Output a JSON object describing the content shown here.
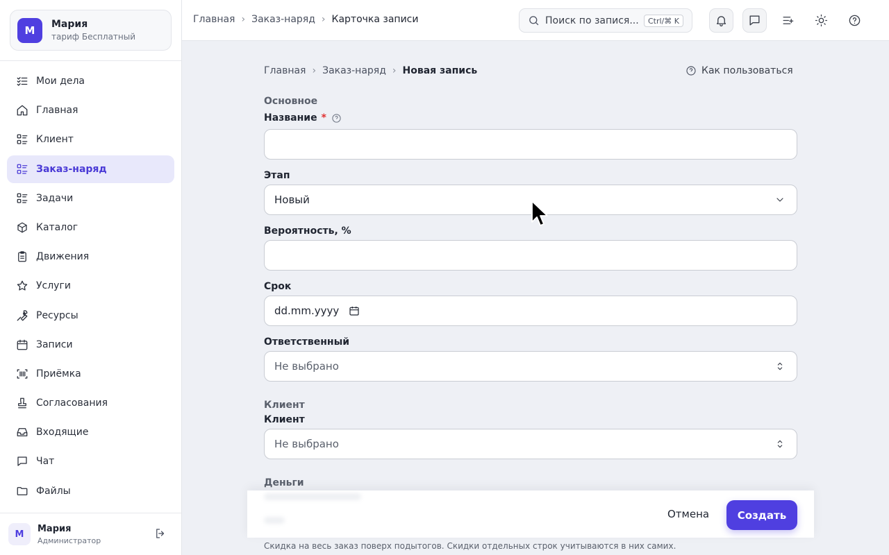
{
  "account": {
    "initial": "M",
    "name": "Мария",
    "plan": "тариф Бесплатный"
  },
  "sidebar": {
    "items": [
      {
        "label": "Мои дела",
        "icon": "checklist-icon"
      },
      {
        "label": "Главная",
        "icon": "home-icon"
      },
      {
        "label": "Клиент",
        "icon": "list-icon"
      },
      {
        "label": "Заказ-наряд",
        "icon": "list-icon",
        "active": true
      },
      {
        "label": "Задачи",
        "icon": "list-icon"
      },
      {
        "label": "Каталог",
        "icon": "box-icon"
      },
      {
        "label": "Движения",
        "icon": "clipboard-icon"
      },
      {
        "label": "Услуги",
        "icon": "star-icon"
      },
      {
        "label": "Ресурсы",
        "icon": "wrench-icon"
      },
      {
        "label": "Записи",
        "icon": "calendar-icon"
      },
      {
        "label": "Приёмка",
        "icon": "scan-icon"
      },
      {
        "label": "Согласования",
        "icon": "stamp-icon"
      },
      {
        "label": "Входящие",
        "icon": "inbox-icon"
      },
      {
        "label": "Чат",
        "icon": "chat-icon"
      },
      {
        "label": "Файлы",
        "icon": "folder-icon"
      }
    ]
  },
  "user": {
    "initial": "M",
    "name": "Мария",
    "role": "Администратор"
  },
  "topbar": {
    "breadcrumb": [
      "Главная",
      "Заказ-наряд",
      "Карточка записи"
    ],
    "search_placeholder": "Поиск по запися...",
    "search_shortcut": "Ctrl/⌘ K"
  },
  "form": {
    "breadcrumb": [
      "Главная",
      "Заказ-наряд",
      "Новая запись"
    ],
    "help_label": "Как пользоваться",
    "section_main": "Основное",
    "name_label": "Название",
    "name_required": "*",
    "name_value": "",
    "stage_label": "Этап",
    "stage_value": "Новый",
    "probability_label": "Вероятность, %",
    "probability_value": "",
    "deadline_label": "Срок",
    "deadline_placeholder": "dd.mm.yyyy",
    "owner_label": "Ответственный",
    "owner_value": "Не выбрано",
    "section_client": "Клиент",
    "client_label": "Клиент",
    "client_value": "Не выбрано",
    "section_money": "Деньги",
    "discount_hint": "Скидка на весь заказ поверх подытогов. Скидки отдельных строк учитываются в них самих."
  },
  "actions": {
    "cancel_label": "Отмена",
    "create_label": "Создать"
  },
  "colors": {
    "accent": "#4f3fe0",
    "active_bg": "#e8e8fb",
    "page_bg": "#eef0f5"
  }
}
